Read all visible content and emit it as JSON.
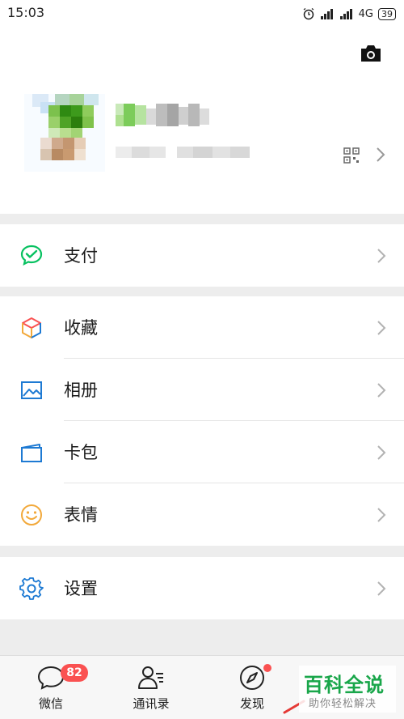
{
  "status_bar": {
    "time": "15:03",
    "network": "4G",
    "battery": "39"
  },
  "profile": {
    "camera_icon": "camera-icon",
    "qr_icon": "qr-code-icon"
  },
  "menu": {
    "pay": {
      "label": "支付",
      "icon": "wechat-pay-icon"
    },
    "favorites": {
      "label": "收藏",
      "icon": "cube-icon"
    },
    "album": {
      "label": "相册",
      "icon": "picture-icon"
    },
    "cards": {
      "label": "卡包",
      "icon": "card-icon"
    },
    "stickers": {
      "label": "表情",
      "icon": "smiley-icon"
    },
    "settings": {
      "label": "设置",
      "icon": "gear-icon"
    }
  },
  "tabbar": {
    "chats": {
      "label": "微信",
      "badge": "82"
    },
    "contacts": {
      "label": "通讯录"
    },
    "discover": {
      "label": "发现"
    }
  },
  "watermark": {
    "title": "百科全说",
    "subtitle": "助你轻松解决"
  },
  "colors": {
    "accent_green": "#07c160",
    "badge_red": "#fa5151",
    "icon_blue": "#1e7ad3",
    "icon_yellow": "#f2a93b"
  }
}
